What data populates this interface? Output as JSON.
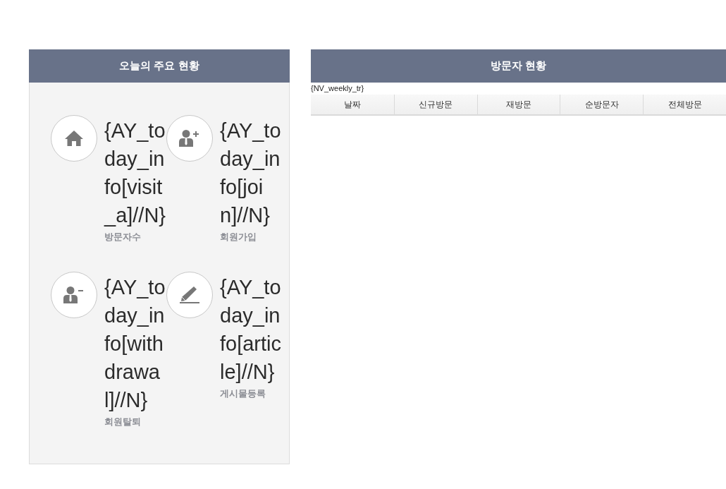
{
  "today_panel": {
    "title": "오늘의 주요 현황",
    "items": [
      {
        "kind": "home",
        "value": "{AY_today_info[visit_a]//N}",
        "label": "방문자수"
      },
      {
        "kind": "user-plus",
        "value": "{AY_today_info[join]//N}",
        "label": "회원가입"
      },
      {
        "kind": "user-minus",
        "value": "{AY_today_info[withdrawal]//N}",
        "label": "회원탈퇴"
      },
      {
        "kind": "pencil",
        "value": "{AY_today_info[article]//N}",
        "label": "게시물등록"
      }
    ]
  },
  "visitor_panel": {
    "title": "방문자 현황",
    "template": "{NV_weekly_tr}",
    "table": {
      "columns": [
        "날짜",
        "신규방문",
        "재방문",
        "순방문자",
        "전체방문"
      ]
    }
  }
}
